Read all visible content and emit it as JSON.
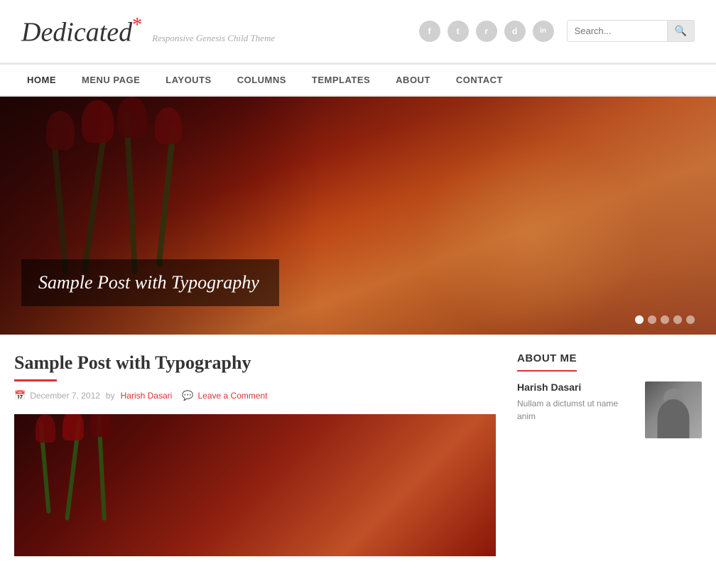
{
  "site": {
    "logo": "Dedicated",
    "asterisk": "*",
    "tagline": "Responsive Genesis Child Theme"
  },
  "social": [
    {
      "name": "facebook",
      "symbol": "f"
    },
    {
      "name": "twitter",
      "symbol": "t"
    },
    {
      "name": "rss",
      "symbol": "r"
    },
    {
      "name": "dribbble",
      "symbol": "d"
    },
    {
      "name": "linkedin",
      "symbol": "in"
    }
  ],
  "search": {
    "placeholder": "Search...",
    "button_symbol": "🔍"
  },
  "nav": {
    "items": [
      {
        "label": "HOME",
        "active": true
      },
      {
        "label": "MENU PAGE",
        "active": false
      },
      {
        "label": "LAYOUTS",
        "active": false
      },
      {
        "label": "COLUMNS",
        "active": false
      },
      {
        "label": "TEMPLATES",
        "active": false
      },
      {
        "label": "ABOUT",
        "active": false
      },
      {
        "label": "CONTACT",
        "active": false
      }
    ]
  },
  "hero": {
    "caption": "Sample Post with Typography",
    "dots": [
      {
        "active": true
      },
      {
        "active": false
      },
      {
        "active": false
      },
      {
        "active": false
      },
      {
        "active": false
      }
    ]
  },
  "post": {
    "title": "Sample Post with Typography",
    "date": "December 7, 2012",
    "author": "Harish Dasari",
    "comment_link": "Leave a Comment"
  },
  "sidebar": {
    "about_widget": {
      "title": "About me",
      "name": "Harish Dasari",
      "description": "Nullam a dictumst ut name anim"
    }
  }
}
